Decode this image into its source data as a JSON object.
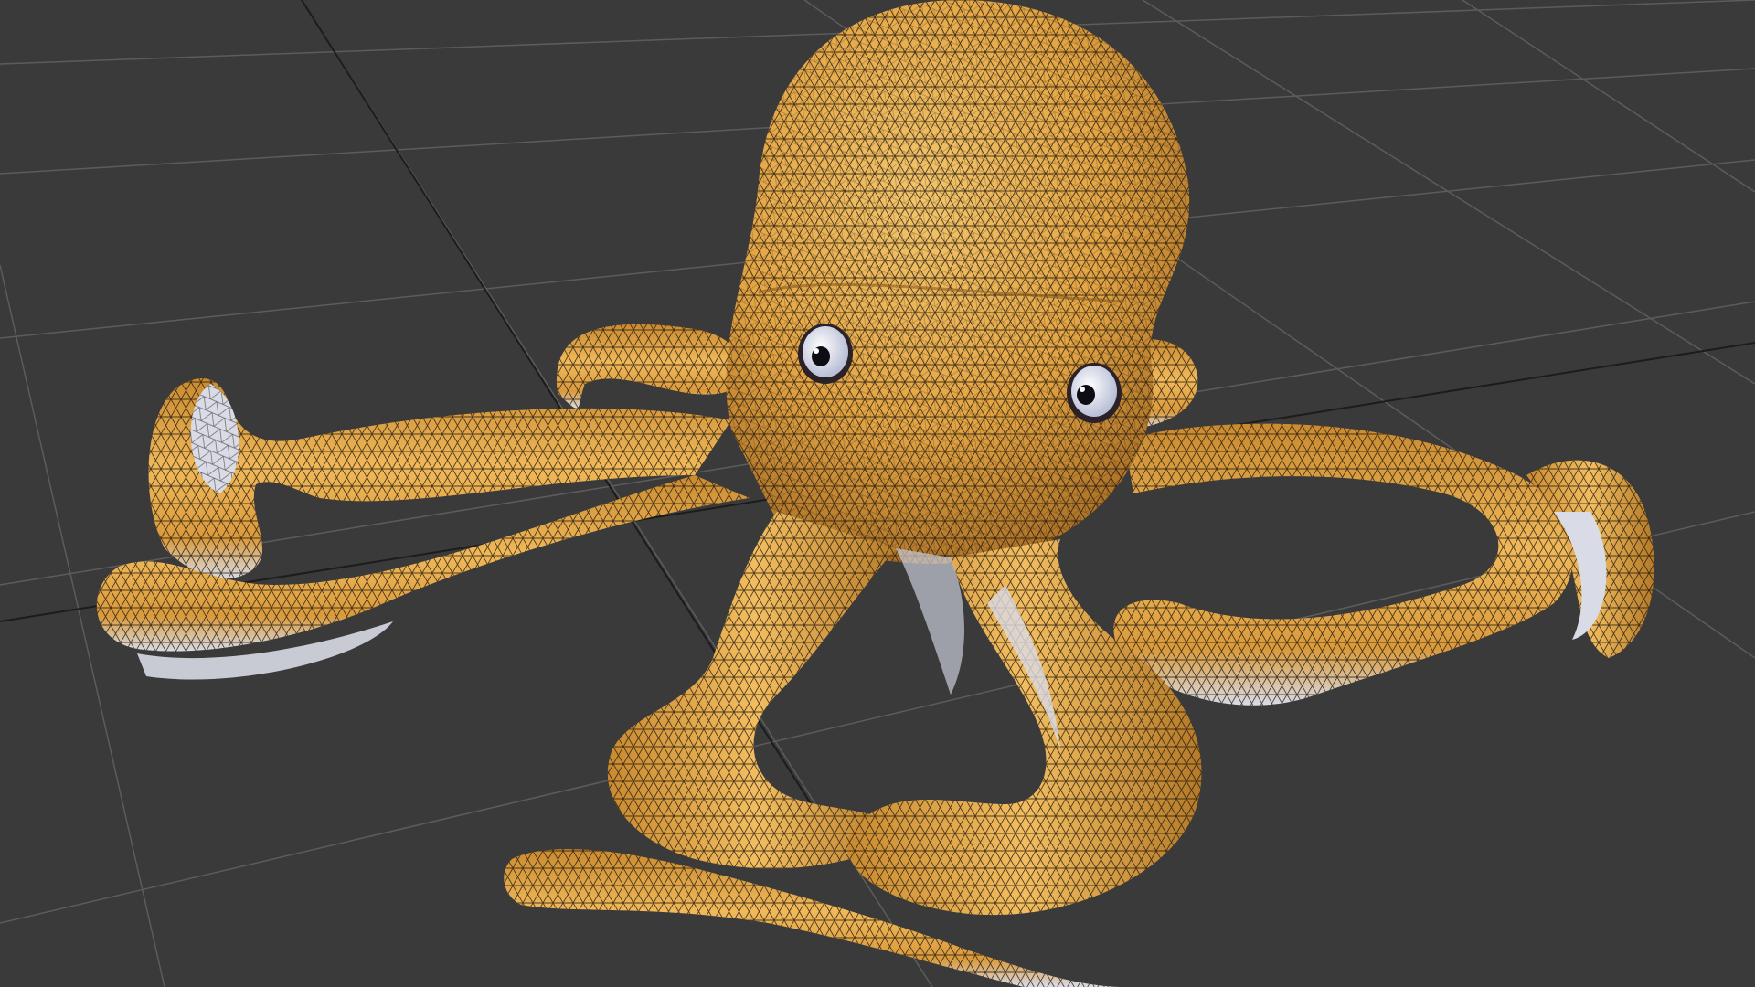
{
  "viewport": {
    "background": "#3a3a3a",
    "grid_color": "#5a5a5a",
    "grid_dark": "#1e1e1e"
  },
  "model": {
    "name_icon": "octopus-mesh",
    "body_color": "#e6a845",
    "shade_color": "#a56a1f",
    "highlight_color": "#f3c56c",
    "underside_color": "#d9dbe6",
    "wire_color": "#1a130a",
    "eye_white": "#dfe3f2",
    "eye_pupil": "#0d0d14"
  }
}
